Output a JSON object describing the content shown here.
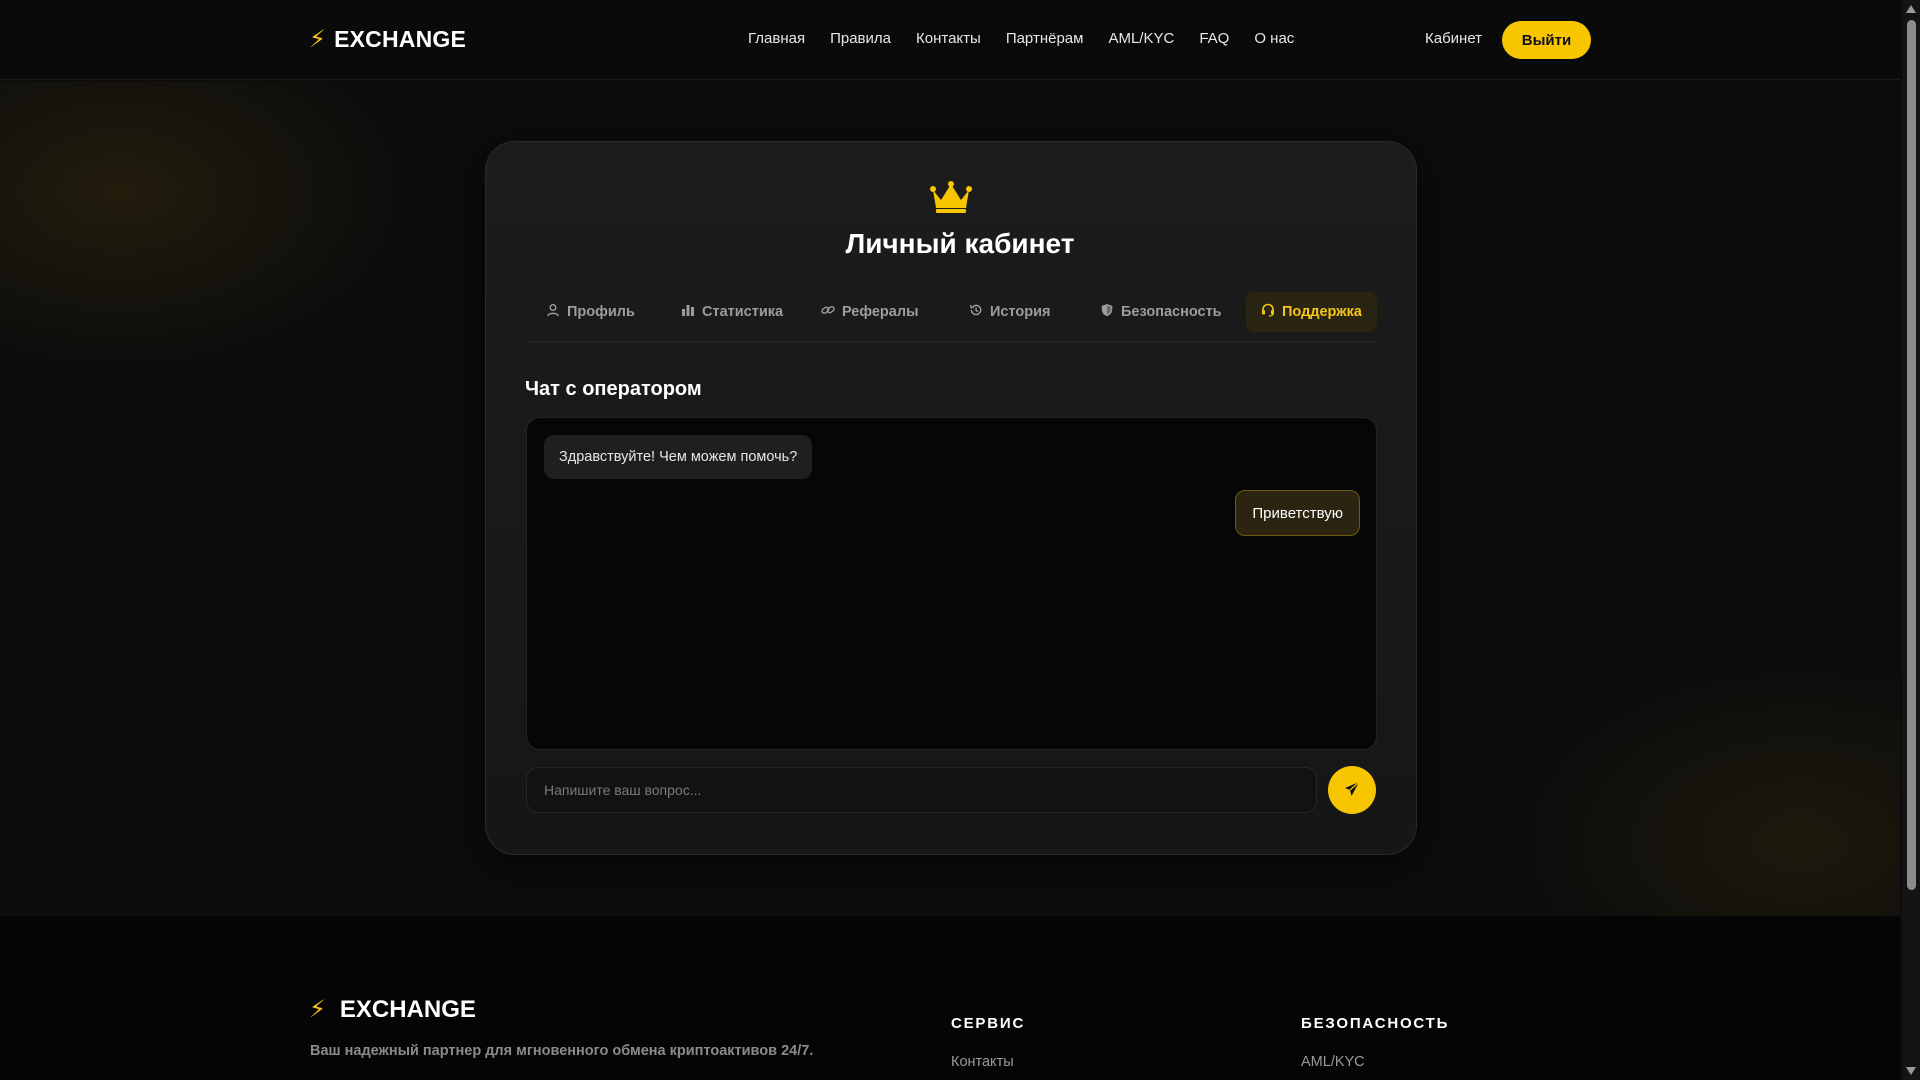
{
  "header": {
    "logo_text": "EXCHANGE",
    "logo_icon": "lightning-bolt-icon",
    "nav": [
      {
        "label": "Главная"
      },
      {
        "label": "Правила"
      },
      {
        "label": "Контакты"
      },
      {
        "label": "Партнёрам"
      },
      {
        "label": "AML/KYC"
      },
      {
        "label": "FAQ"
      },
      {
        "label": "О нас"
      }
    ],
    "cabinet_label": "Кабинет",
    "logout_label": "Выйти"
  },
  "card": {
    "icon": "crown-icon",
    "title": "Личный кабинет",
    "tabs": [
      {
        "label": "Профиль",
        "icon": "user-icon"
      },
      {
        "label": "Статистика",
        "icon": "bar-chart-icon"
      },
      {
        "label": "Рефералы",
        "icon": "link-icon"
      },
      {
        "label": "История",
        "icon": "history-icon"
      },
      {
        "label": "Безопасность",
        "icon": "shield-icon"
      },
      {
        "label": "Поддержка",
        "icon": "headset-icon",
        "active": true
      }
    ],
    "chat": {
      "heading": "Чат с оператором",
      "messages": [
        {
          "from": "operator",
          "text": "Здравствуйте! Чем можем помочь?"
        },
        {
          "from": "user",
          "text": "Приветствую"
        }
      ],
      "input_placeholder": "Напишите ваш вопрос...",
      "input_value": "",
      "send_icon": "paper-plane-icon"
    }
  },
  "footer": {
    "logo_text": "EXCHANGE",
    "tagline": "Ваш надежный партнер для мгновенного обмена криптоактивов 24/7.",
    "columns": [
      {
        "title": "СЕРВИС",
        "links": [
          "Контакты"
        ]
      },
      {
        "title": "БЕЗОПАСНОСТЬ",
        "links": [
          "AML/KYC"
        ]
      }
    ]
  },
  "colors": {
    "accent": "#f7c600",
    "background": "#0b0b0b",
    "card": "#1c1c1c"
  }
}
